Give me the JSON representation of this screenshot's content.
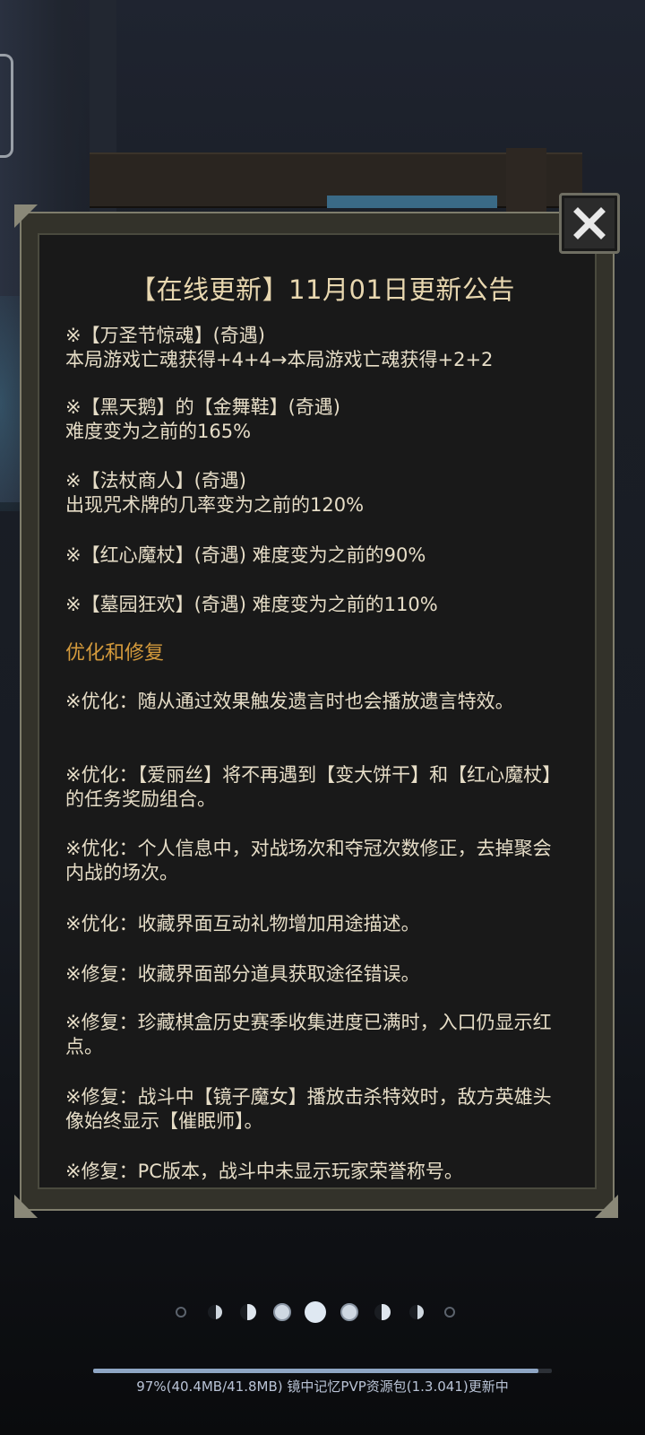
{
  "title": "【在线更新】11月01日更新公告",
  "entries": [
    {
      "line1": "※【万圣节惊魂】(奇遇)",
      "line2": "本局游戏亡魂获得+4+4→本局游戏亡魂获得+2+2"
    },
    {
      "line1": "※【黑天鹅】的【金舞鞋】(奇遇)",
      "line2": "难度变为之前的165%"
    },
    {
      "line1": "※【法杖商人】(奇遇)",
      "line2": "出现咒术牌的几率变为之前的120%"
    },
    {
      "line1": "※【红心魔杖】(奇遇) 难度变为之前的90%"
    },
    {
      "line1": "※【墓园狂欢】(奇遇) 难度变为之前的110%"
    }
  ],
  "section_heading": "优化和修复",
  "fixes": [
    "※优化：随从通过效果触发遗言时也会播放遗言特效。",
    "※优化：【爱丽丝】将不再遇到【变大饼干】和【红心魔杖】的任务奖励组合。",
    "※优化：个人信息中，对战场次和夺冠次数修正，去掉聚会内战的场次。",
    "※优化：收藏界面互动礼物增加用途描述。",
    "※修复：收藏界面部分道具获取途径错误。",
    "※修复：珍藏棋盒历史赛季收集进度已满时，入口仍显示红点。",
    "※修复：战斗中【镜子魔女】播放击杀特效时，敌方英雄头像始终显示【催眠师】。",
    "※修复：PC版本，战斗中未显示玩家荣誉称号。"
  ],
  "close_icon": "close-x-icon",
  "pager": {
    "count": 9,
    "active_index": 4
  },
  "download": {
    "progress_percent": 97,
    "status_text": "97%(40.4MB/41.8MB)  镜中记忆PVP资源包(1.3.041)更新中"
  },
  "colors": {
    "title": "#e9d8b0",
    "text": "#e6ddc7",
    "section": "#d49a3c",
    "panel_border": "#7f7d6c"
  }
}
